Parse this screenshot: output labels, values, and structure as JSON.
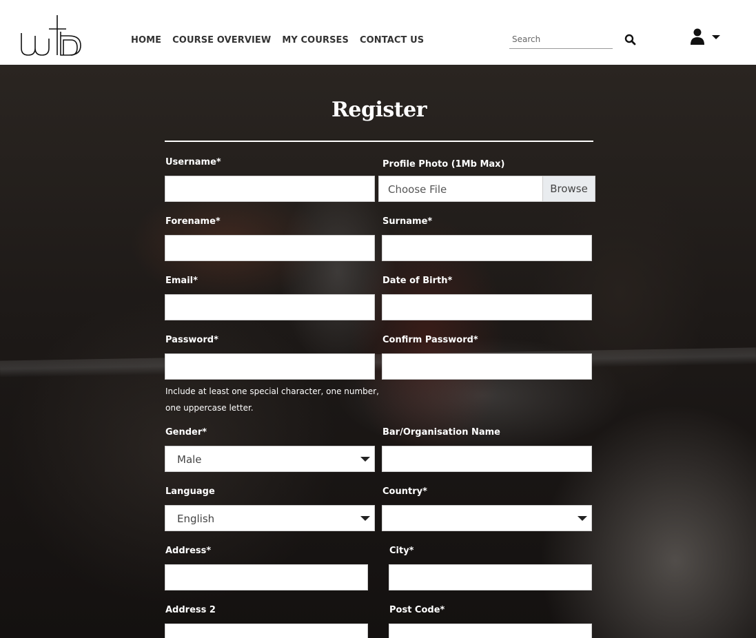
{
  "nav": {
    "logo_alt": "wb",
    "items": [
      "HOME",
      "COURSE OVERVIEW",
      "MY COURSES",
      "CONTACT US"
    ]
  },
  "search": {
    "placeholder": "Search"
  },
  "form": {
    "title": "Register",
    "username": {
      "label": "Username*",
      "value": ""
    },
    "photo": {
      "label": "Profile Photo (1Mb Max)",
      "text": "Choose File",
      "browse": "Browse"
    },
    "forename": {
      "label": "Forename*",
      "value": ""
    },
    "surname": {
      "label": "Surname*",
      "value": ""
    },
    "email": {
      "label": "Email*",
      "value": ""
    },
    "dob": {
      "label": "Date of Birth*",
      "value": ""
    },
    "password": {
      "label": "Password*",
      "value": ""
    },
    "confirm": {
      "label": "Confirm Password*",
      "value": ""
    },
    "password_hint": "Include at least one special character, one number, one uppercase letter.",
    "gender": {
      "label": "Gender*",
      "value": "Male"
    },
    "org": {
      "label": "Bar/Organisation Name",
      "value": ""
    },
    "language": {
      "label": "Language",
      "value": "English"
    },
    "country": {
      "label": "Country*",
      "value": ""
    },
    "address": {
      "label": "Address*",
      "value": ""
    },
    "city": {
      "label": "City*",
      "value": ""
    },
    "address2": {
      "label": "Address 2",
      "value": ""
    },
    "postcode": {
      "label": "Post Code*",
      "value": ""
    }
  },
  "colors": {
    "header_bg": "#ffffff",
    "nav_text": "#333333",
    "form_text": "#ffffff"
  },
  "icons": [
    "logo",
    "search-icon",
    "user-icon",
    "caret-down-icon"
  ]
}
